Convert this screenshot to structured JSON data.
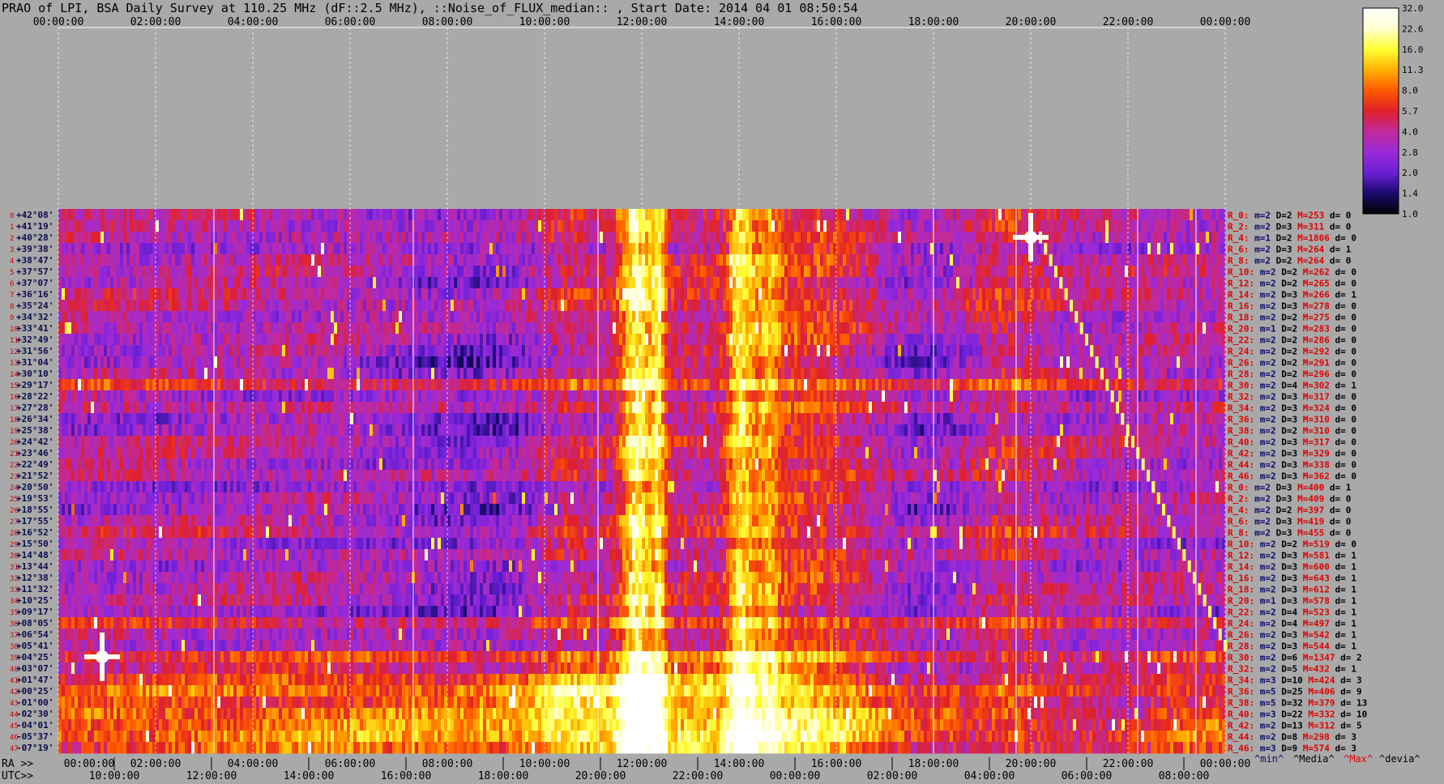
{
  "title": "PRAO of LPI, BSA Daily Survey at 110.25 MHz (dF::2.5 MHz), ::Noise_of_FLUX_median:: , Start Date: 2014 04 01 08:50:54",
  "chart_data": {
    "type": "heatmap",
    "top_axis_ticks": [
      "00:00:00",
      "02:00:00",
      "04:00:00",
      "06:00:00",
      "08:00:00",
      "10:00:00",
      "12:00:00",
      "14:00:00",
      "16:00:00",
      "18:00:00",
      "20:00:00",
      "22:00:00",
      "00:00:00"
    ],
    "ra_axis_prefix": "RA >>",
    "ra_axis_ticks": [
      "00:00:00",
      "02:00:00",
      "04:00:00",
      "06:00:00",
      "08:00:00",
      "10:00:00",
      "12:00:00",
      "14:00:00",
      "16:00:00",
      "18:00:00",
      "20:00:00",
      "22:00:00",
      "00:00:00"
    ],
    "utc_axis_prefix": "UTC>>",
    "utc_axis_ticks": [
      "10:00:00",
      "12:00:00",
      "14:00:00",
      "16:00:00",
      "18:00:00",
      "20:00:00",
      "22:00:00",
      "00:00:00",
      "02:00:00",
      "04:00:00",
      "06:00:00",
      "08:00:00"
    ],
    "declinations": [
      "+42°08'",
      "+41°19'",
      "+40°28'",
      "+39°38'",
      "+38°47'",
      "+37°57'",
      "+37°07'",
      "+36°16'",
      "+35°24'",
      "+34°32'",
      "+33°41'",
      "+32°49'",
      "+31°56'",
      "+31°04'",
      "+30°10'",
      "+29°17'",
      "+28°22'",
      "+27°28'",
      "+26°34'",
      "+25°38'",
      "+24°42'",
      "+23°46'",
      "+22°49'",
      "+21°52'",
      "+20°50'",
      "+19°53'",
      "+18°55'",
      "+17°55'",
      "+16°52'",
      "+15°50'",
      "+14°48'",
      "+13°44'",
      "+12°38'",
      "+11°32'",
      "+10°25'",
      "+09°17'",
      "+08°05'",
      "+06°54'",
      "+05°41'",
      "+04°25'",
      "+03°07'",
      "+01°47'",
      "+00°25'",
      "-01°00'",
      "-02°30'",
      "-04°01'",
      "-05°37'",
      "-07°19'"
    ],
    "row_numbers": [
      "0",
      "1",
      "2",
      "3",
      "4",
      "5",
      "6",
      "7",
      "8",
      "9",
      "10",
      "11",
      "12",
      "13",
      "14",
      "15",
      "16",
      "17",
      "18",
      "19",
      "20",
      "21",
      "22",
      "23",
      "24",
      "25",
      "26",
      "27",
      "28",
      "29",
      "30",
      "31",
      "32",
      "33",
      "34",
      "35",
      "36",
      "37",
      "38",
      "39",
      "40",
      "41",
      "42",
      "43",
      "44",
      "45",
      "46",
      "47"
    ],
    "row_stats": [
      {
        "r": "R_0:",
        "m": "m=2",
        "D": "D=2",
        "M": "M=253",
        "d": "d= 0"
      },
      {
        "r": "R_2:",
        "m": "m=2",
        "D": "D=3",
        "M": "M=311",
        "d": "d= 0"
      },
      {
        "r": "R_4:",
        "m": "m=1",
        "D": "D=2",
        "M": "M=1806",
        "d": "d= 0"
      },
      {
        "r": "R_6:",
        "m": "m=2",
        "D": "D=3",
        "M": "M=264",
        "d": "d= 1"
      },
      {
        "r": "R_8:",
        "m": "m=2",
        "D": "D=2",
        "M": "M=264",
        "d": "d= 0"
      },
      {
        "r": "R_10:",
        "m": "m=2",
        "D": "D=2",
        "M": "M=262",
        "d": "d= 0"
      },
      {
        "r": "R_12:",
        "m": "m=2",
        "D": "D=2",
        "M": "M=265",
        "d": "d= 0"
      },
      {
        "r": "R_14:",
        "m": "m=2",
        "D": "D=3",
        "M": "M=266",
        "d": "d= 1"
      },
      {
        "r": "R_16:",
        "m": "m=2",
        "D": "D=3",
        "M": "M=278",
        "d": "d= 0"
      },
      {
        "r": "R_18:",
        "m": "m=2",
        "D": "D=2",
        "M": "M=275",
        "d": "d= 0"
      },
      {
        "r": "R_20:",
        "m": "m=1",
        "D": "D=2",
        "M": "M=283",
        "d": "d= 0"
      },
      {
        "r": "R_22:",
        "m": "m=2",
        "D": "D=2",
        "M": "M=286",
        "d": "d= 0"
      },
      {
        "r": "R_24:",
        "m": "m=2",
        "D": "D=2",
        "M": "M=292",
        "d": "d= 0"
      },
      {
        "r": "R_26:",
        "m": "m=2",
        "D": "D=2",
        "M": "M=291",
        "d": "d= 0"
      },
      {
        "r": "R_28:",
        "m": "m=2",
        "D": "D=2",
        "M": "M=296",
        "d": "d= 0"
      },
      {
        "r": "R_30:",
        "m": "m=2",
        "D": "D=4",
        "M": "M=302",
        "d": "d= 1"
      },
      {
        "r": "R_32:",
        "m": "m=2",
        "D": "D=3",
        "M": "M=317",
        "d": "d= 0"
      },
      {
        "r": "R_34:",
        "m": "m=2",
        "D": "D=3",
        "M": "M=324",
        "d": "d= 0"
      },
      {
        "r": "R_36:",
        "m": "m=2",
        "D": "D=3",
        "M": "M=310",
        "d": "d= 0"
      },
      {
        "r": "R_38:",
        "m": "m=2",
        "D": "D=2",
        "M": "M=310",
        "d": "d= 0"
      },
      {
        "r": "R_40:",
        "m": "m=2",
        "D": "D=3",
        "M": "M=317",
        "d": "d= 0"
      },
      {
        "r": "R_42:",
        "m": "m=2",
        "D": "D=3",
        "M": "M=329",
        "d": "d= 0"
      },
      {
        "r": "R_44:",
        "m": "m=2",
        "D": "D=3",
        "M": "M=338",
        "d": "d= 0"
      },
      {
        "r": "R_46:",
        "m": "m=2",
        "D": "D=3",
        "M": "M=362",
        "d": "d= 0"
      },
      {
        "r": "R_0:",
        "m": "m=2",
        "D": "D=3",
        "M": "M=400",
        "d": "d= 1"
      },
      {
        "r": "R_2:",
        "m": "m=2",
        "D": "D=3",
        "M": "M=409",
        "d": "d= 0"
      },
      {
        "r": "R_4:",
        "m": "m=2",
        "D": "D=2",
        "M": "M=397",
        "d": "d= 0"
      },
      {
        "r": "R_6:",
        "m": "m=2",
        "D": "D=3",
        "M": "M=419",
        "d": "d= 0"
      },
      {
        "r": "R_8:",
        "m": "m=2",
        "D": "D=3",
        "M": "M=455",
        "d": "d= 0"
      },
      {
        "r": "R_10:",
        "m": "m=2",
        "D": "D=2",
        "M": "M=519",
        "d": "d= 0"
      },
      {
        "r": "R_12:",
        "m": "m=2",
        "D": "D=3",
        "M": "M=581",
        "d": "d= 1"
      },
      {
        "r": "R_14:",
        "m": "m=2",
        "D": "D=3",
        "M": "M=600",
        "d": "d= 1"
      },
      {
        "r": "R_16:",
        "m": "m=2",
        "D": "D=3",
        "M": "M=643",
        "d": "d= 1"
      },
      {
        "r": "R_18:",
        "m": "m=2",
        "D": "D=3",
        "M": "M=612",
        "d": "d= 1"
      },
      {
        "r": "R_20:",
        "m": "m=1",
        "D": "D=3",
        "M": "M=578",
        "d": "d= 1"
      },
      {
        "r": "R_22:",
        "m": "m=2",
        "D": "D=4",
        "M": "M=523",
        "d": "d= 1"
      },
      {
        "r": "R_24:",
        "m": "m=2",
        "D": "D=4",
        "M": "M=497",
        "d": "d= 1"
      },
      {
        "r": "R_26:",
        "m": "m=2",
        "D": "D=3",
        "M": "M=542",
        "d": "d= 1"
      },
      {
        "r": "R_28:",
        "m": "m=2",
        "D": "D=3",
        "M": "M=544",
        "d": "d= 1"
      },
      {
        "r": "R_30:",
        "m": "m=2",
        "D": "D=6",
        "M": "M=1347",
        "d": "d= 2"
      },
      {
        "r": "R_32:",
        "m": "m=2",
        "D": "D=5",
        "M": "M=432",
        "d": "d= 1"
      },
      {
        "r": "R_34:",
        "m": "m=3",
        "D": "D=10",
        "M": "M=424",
        "d": "d= 3"
      },
      {
        "r": "R_36:",
        "m": "m=5",
        "D": "D=25",
        "M": "M=406",
        "d": "d= 9"
      },
      {
        "r": "R_38:",
        "m": "m=5",
        "D": "D=32",
        "M": "M=379",
        "d": "d= 13"
      },
      {
        "r": "R_40:",
        "m": "m=3",
        "D": "D=22",
        "M": "M=332",
        "d": "d= 10"
      },
      {
        "r": "R_42:",
        "m": "m=2",
        "D": "D=13",
        "M": "M=312",
        "d": "d= 5"
      },
      {
        "r": "R_44:",
        "m": "m=2",
        "D": "D=8",
        "M": "M=298",
        "d": "d= 3"
      },
      {
        "r": "R_46:",
        "m": "m=3",
        "D": "D=9",
        "M": "M=574",
        "d": "d= 3"
      }
    ],
    "stats_legend": [
      "^min^",
      "^Media^",
      "^Max^",
      "^devia^"
    ],
    "colorbar": {
      "labels": [
        "32.0",
        "22.6",
        "16.0",
        "11.3",
        "8.0",
        "5.7",
        "4.0",
        "2.8",
        "2.0",
        "1.4",
        "1.0"
      ],
      "scale": "log",
      "range": [
        1.0,
        32.0
      ],
      "colors": [
        "#000000",
        "#1a0a6e",
        "#6a1fd6",
        "#9a2ad8",
        "#c22a9a",
        "#e0202a",
        "#ff5a00",
        "#ffb000",
        "#ffff33",
        "#ffffd0",
        "#ffffff"
      ]
    },
    "features": [
      {
        "type": "band",
        "name": "galactic-plane-bright-band",
        "dec_range": [
          "+01°47'",
          "-07°19'"
        ],
        "intensity": "max"
      },
      {
        "type": "vertical-strip",
        "name": "cygnus-transit-strip",
        "ra": "12:00:00",
        "intensity": "high"
      },
      {
        "type": "vertical-strip",
        "name": "strip-14h",
        "ra": "14:00:00",
        "intensity": "high"
      },
      {
        "type": "diagonal-track",
        "name": "moving-source-track",
        "start_ra": "20:00:00",
        "start_dec": "+40°28'",
        "end_ra": "00:00:00",
        "end_dec": "+05°41'"
      },
      {
        "type": "cross-source",
        "name": "bright-source-20h",
        "ra": "20:00:00",
        "dec": "+40°28'"
      },
      {
        "type": "cross-source",
        "name": "bright-source-01h",
        "ra": "01:00:00",
        "dec": "+04°25'"
      }
    ]
  }
}
